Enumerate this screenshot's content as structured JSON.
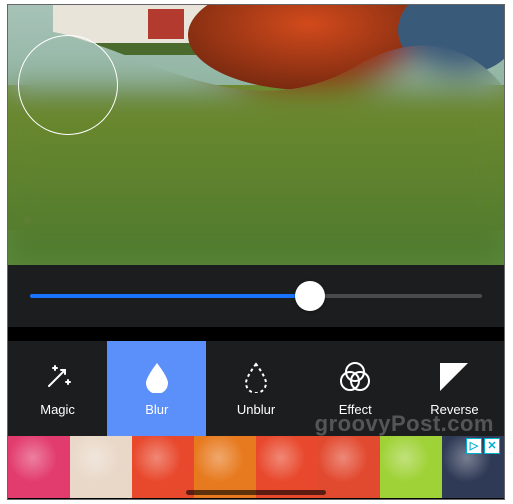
{
  "slider": {
    "percent": 62
  },
  "tools": [
    {
      "key": "magic",
      "label": "Magic",
      "active": false
    },
    {
      "key": "blur",
      "label": "Blur",
      "active": true
    },
    {
      "key": "unblur",
      "label": "Unblur",
      "active": false
    },
    {
      "key": "effect",
      "label": "Effect",
      "active": false
    },
    {
      "key": "reverse",
      "label": "Reverse",
      "active": false
    }
  ],
  "ad": {
    "badges": [
      "▷",
      "✕"
    ],
    "colors": [
      "#e23b6d",
      "#e9d8c8",
      "#e8482c",
      "#e77a1f",
      "#e8482c",
      "#e24a30",
      "#9fd236",
      "#2f3a56"
    ]
  },
  "watermark": "groovyPost.com"
}
